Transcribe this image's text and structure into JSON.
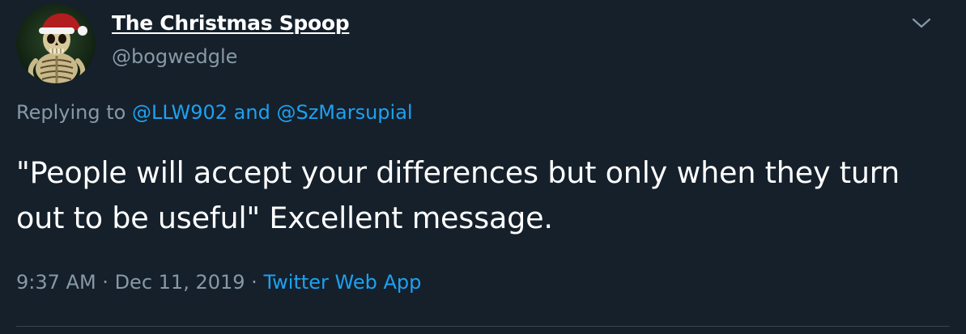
{
  "tweet": {
    "display_name": "The Christmas Spoop",
    "handle": "@bogwedgle",
    "replying_prefix": "Replying to",
    "reply_mention_1": "@LLW902",
    "reply_joiner": "and",
    "reply_mention_2": "@SzMarsupial",
    "text": "\"People will accept your differences but only when they turn out to be useful\" Excellent message.",
    "time": "9:37 AM",
    "separator_1": "·",
    "date": "Dec 11, 2019",
    "separator_2": "·",
    "source": "Twitter Web App"
  },
  "icons": {
    "avatar": "skeleton-santa-hat-avatar",
    "menu": "chevron-down-icon"
  },
  "colors": {
    "background": "#15202b",
    "primary_text": "#ffffff",
    "secondary_text": "#8899a6",
    "link": "#1da1f2",
    "divider": "#38444d"
  }
}
